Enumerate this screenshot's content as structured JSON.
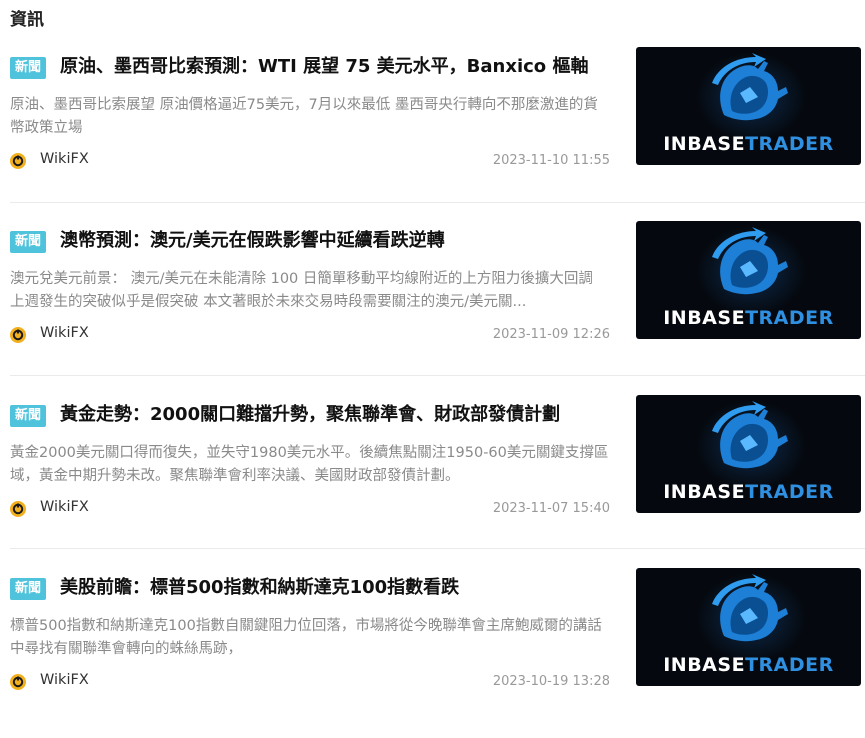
{
  "section": {
    "title": "資訊"
  },
  "articles": [
    {
      "tag": "新聞",
      "title": "原油、墨西哥比索預測：WTI 展望 75 美元水平，Banxico 樞軸",
      "summary": "原油、墨西哥比索展望 原油價格逼近75美元，7月以來最低 墨西哥央行轉向不那麼激進的貨幣政策立場",
      "source": "WikiFX",
      "date": "2023-11-10 11:55",
      "thumb_brand_1": "INBASE",
      "thumb_brand_2": "TRADER"
    },
    {
      "tag": "新聞",
      "title": "澳幣預測：澳元/美元在假跌影響中延續看跌逆轉",
      "summary": "澳元兌美元前景： 澳元/美元在未能清除 100 日簡單移動平均線附近的上方阻力後擴大回調 上週發生的突破似乎是假突破 本文著眼於未來交易時段需要關注的澳元/美元關...",
      "source": "WikiFX",
      "date": "2023-11-09 12:26",
      "thumb_brand_1": "INBASE",
      "thumb_brand_2": "TRADER"
    },
    {
      "tag": "新聞",
      "title": "黃金走勢：2000關口難擋升勢，聚焦聯準會、財政部發債計劃",
      "summary": "黃金2000美元關口得而復失，並失守1980美元水平。後續焦點關注1950-60美元關鍵支撐區域，黃金中期升勢未改。聚焦聯準會利率決議、美國財政部發債計劃。",
      "source": "WikiFX",
      "date": "2023-11-07 15:40",
      "thumb_brand_1": "INBASE",
      "thumb_brand_2": "TRADER"
    },
    {
      "tag": "新聞",
      "title": "美股前瞻：標普500指數和納斯達克100指數看跌",
      "summary": "標普500指數和納斯達克100指數自關鍵阻力位回落，市場將從今晚聯準會主席鮑威爾的講話中尋找有關聯準會轉向的蛛絲馬跡，",
      "source": "WikiFX",
      "date": "2023-10-19 13:28",
      "thumb_brand_1": "INBASE",
      "thumb_brand_2": "TRADER"
    }
  ],
  "colors": {
    "tag_bg": "#4fc3dc",
    "summary_text": "#8a8a8a",
    "brand_blue": "#2f8fe0",
    "thumb_bg": "#05090f",
    "source_icon": "#f2b01e"
  }
}
